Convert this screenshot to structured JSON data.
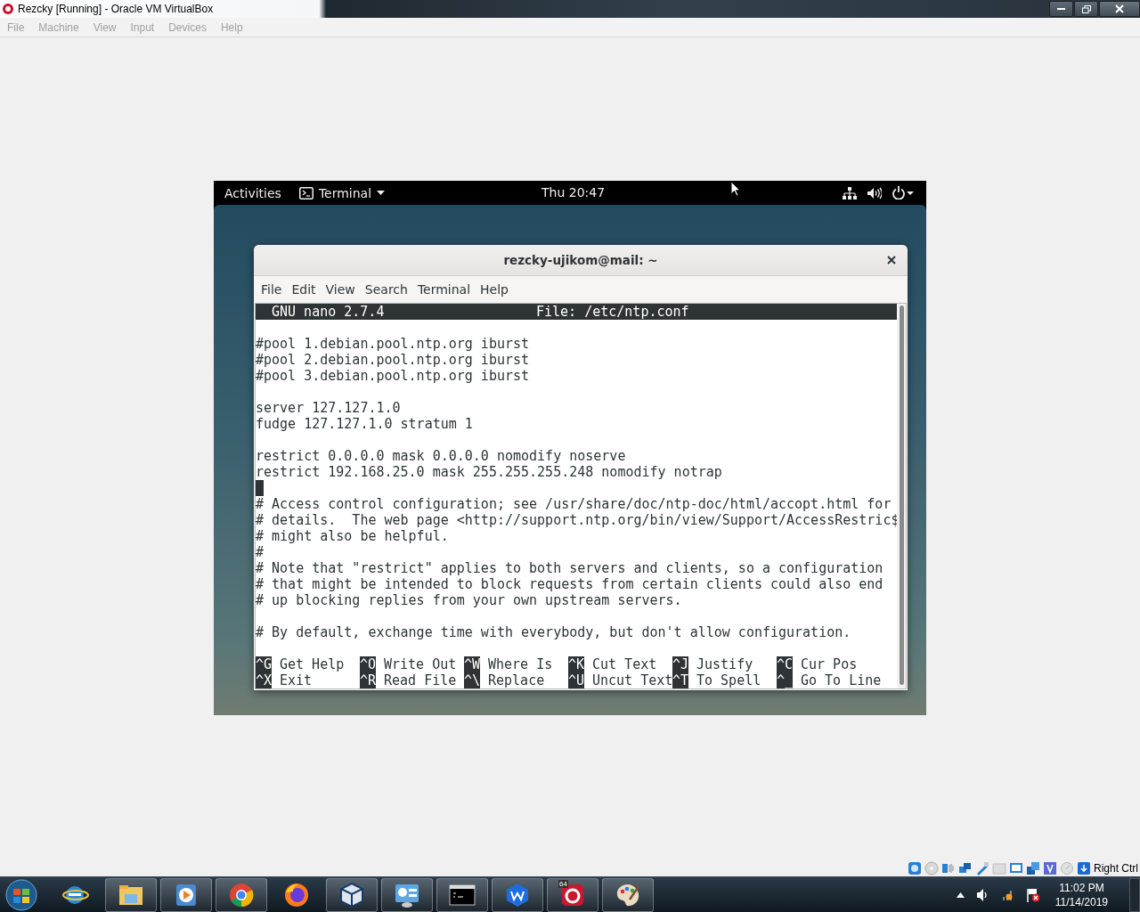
{
  "window": {
    "title": "Rezcky [Running] - Oracle VM VirtualBox"
  },
  "menu": [
    {
      "label": "File",
      "disabled": true
    },
    {
      "label": "Machine",
      "disabled": true
    },
    {
      "label": "View",
      "disabled": true
    },
    {
      "label": "Input",
      "disabled": true
    },
    {
      "label": "Devices",
      "disabled": true
    },
    {
      "label": "Help",
      "disabled": true
    }
  ],
  "vm": {
    "topbar": {
      "activities": "Activities",
      "app": "Terminal",
      "clock": "Thu 20:47"
    },
    "terminal": {
      "title": "rezcky-ujikom@mail: ~",
      "menu": [
        "File",
        "Edit",
        "View",
        "Search",
        "Terminal",
        "Help"
      ],
      "nano": {
        "version": "GNU nano 2.7.4",
        "file": "File: /etc/ntp.conf",
        "lines": [
          {
            "kind": "blank"
          },
          {
            "kind": "text",
            "text": "#pool 1.debian.pool.ntp.org iburst"
          },
          {
            "kind": "text",
            "text": "#pool 2.debian.pool.ntp.org iburst"
          },
          {
            "kind": "text",
            "text": "#pool 3.debian.pool.ntp.org iburst"
          },
          {
            "kind": "blank"
          },
          {
            "kind": "text",
            "text": "server 127.127.1.0"
          },
          {
            "kind": "text",
            "text": "fudge 127.127.1.0 stratum 1"
          },
          {
            "kind": "blank"
          },
          {
            "kind": "text",
            "text": "restrict 0.0.0.0 mask 0.0.0.0 nomodify noserve"
          },
          {
            "kind": "text",
            "text": "restrict 192.168.25.0 mask 255.255.255.248 nomodify notrap"
          },
          {
            "kind": "cursor"
          },
          {
            "kind": "text",
            "text": "# Access control configuration; see /usr/share/doc/ntp-doc/html/accopt.html for"
          },
          {
            "kind": "text",
            "text": "# details.  The web page <http://support.ntp.org/bin/view/Support/AccessRestric$"
          },
          {
            "kind": "text",
            "text": "# might also be helpful."
          },
          {
            "kind": "text",
            "text": "#"
          },
          {
            "kind": "text",
            "text": "# Note that \"restrict\" applies to both servers and clients, so a configuration"
          },
          {
            "kind": "text",
            "text": "# that might be intended to block requests from certain clients could also end"
          },
          {
            "kind": "text",
            "text": "# up blocking replies from your own upstream servers."
          },
          {
            "kind": "blank"
          },
          {
            "kind": "text",
            "text": "# By default, exchange time with everybody, but don't allow configuration."
          },
          {
            "kind": "blank"
          }
        ],
        "shortcuts": [
          [
            {
              "key": "^G",
              "label": "Get Help"
            },
            {
              "key": "^O",
              "label": "Write Out"
            },
            {
              "key": "^W",
              "label": "Where Is"
            },
            {
              "key": "^K",
              "label": "Cut Text"
            },
            {
              "key": "^J",
              "label": "Justify"
            },
            {
              "key": "^C",
              "label": "Cur Pos"
            }
          ],
          [
            {
              "key": "^X",
              "label": "Exit"
            },
            {
              "key": "^R",
              "label": "Read File"
            },
            {
              "key": "^\\",
              "label": "Replace"
            },
            {
              "key": "^U",
              "label": "Uncut Text"
            },
            {
              "key": "^T",
              "label": "To Spell"
            },
            {
              "key": "^_",
              "label": "Go To Line"
            }
          ]
        ]
      }
    }
  },
  "status_bar": {
    "host_key": "Right Ctrl"
  },
  "taskbar": {
    "apps": [
      {
        "kind": "ie",
        "running": false
      },
      {
        "kind": "explorer",
        "running": true
      },
      {
        "kind": "media",
        "running": true
      },
      {
        "kind": "chrome",
        "running": true
      },
      {
        "kind": "firefox",
        "running": false
      },
      {
        "kind": "virtualbox",
        "running": true
      },
      {
        "kind": "control",
        "running": true
      },
      {
        "kind": "cmd",
        "running": true
      },
      {
        "kind": "wps",
        "running": true
      },
      {
        "kind": "ring",
        "running": true,
        "badge": "64"
      },
      {
        "kind": "paint",
        "running": true
      }
    ],
    "clock": {
      "time": "11:02 PM",
      "date": "11/14/2019"
    }
  }
}
